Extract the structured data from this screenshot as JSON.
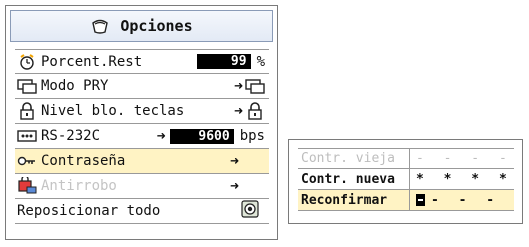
{
  "options_menu": {
    "title": "Opciones",
    "items": [
      {
        "label": "Porcent.Rest",
        "value": "99",
        "unit": "%"
      },
      {
        "label": "Modo PRY",
        "action": "➜"
      },
      {
        "label": "Nivel blo. teclas",
        "action": "➜"
      },
      {
        "label": "RS-232C",
        "action": "➜",
        "value": "9600",
        "unit": "bps"
      },
      {
        "label": "Contraseña",
        "action": "➜"
      },
      {
        "label": "Antirrobo",
        "action": "➜"
      },
      {
        "label": "Reposicionar todo"
      }
    ]
  },
  "password_dialog": {
    "rows": [
      {
        "label": "Contr. vieja",
        "value": "- - - -"
      },
      {
        "label": "Contr. nueva",
        "value": "* * * *"
      },
      {
        "label": "Reconfirmar",
        "value": "- - -"
      }
    ]
  },
  "colors": {
    "highlight": "#fff3c4",
    "border": "#7a7a7a",
    "disabled": "#c4c4c4"
  }
}
